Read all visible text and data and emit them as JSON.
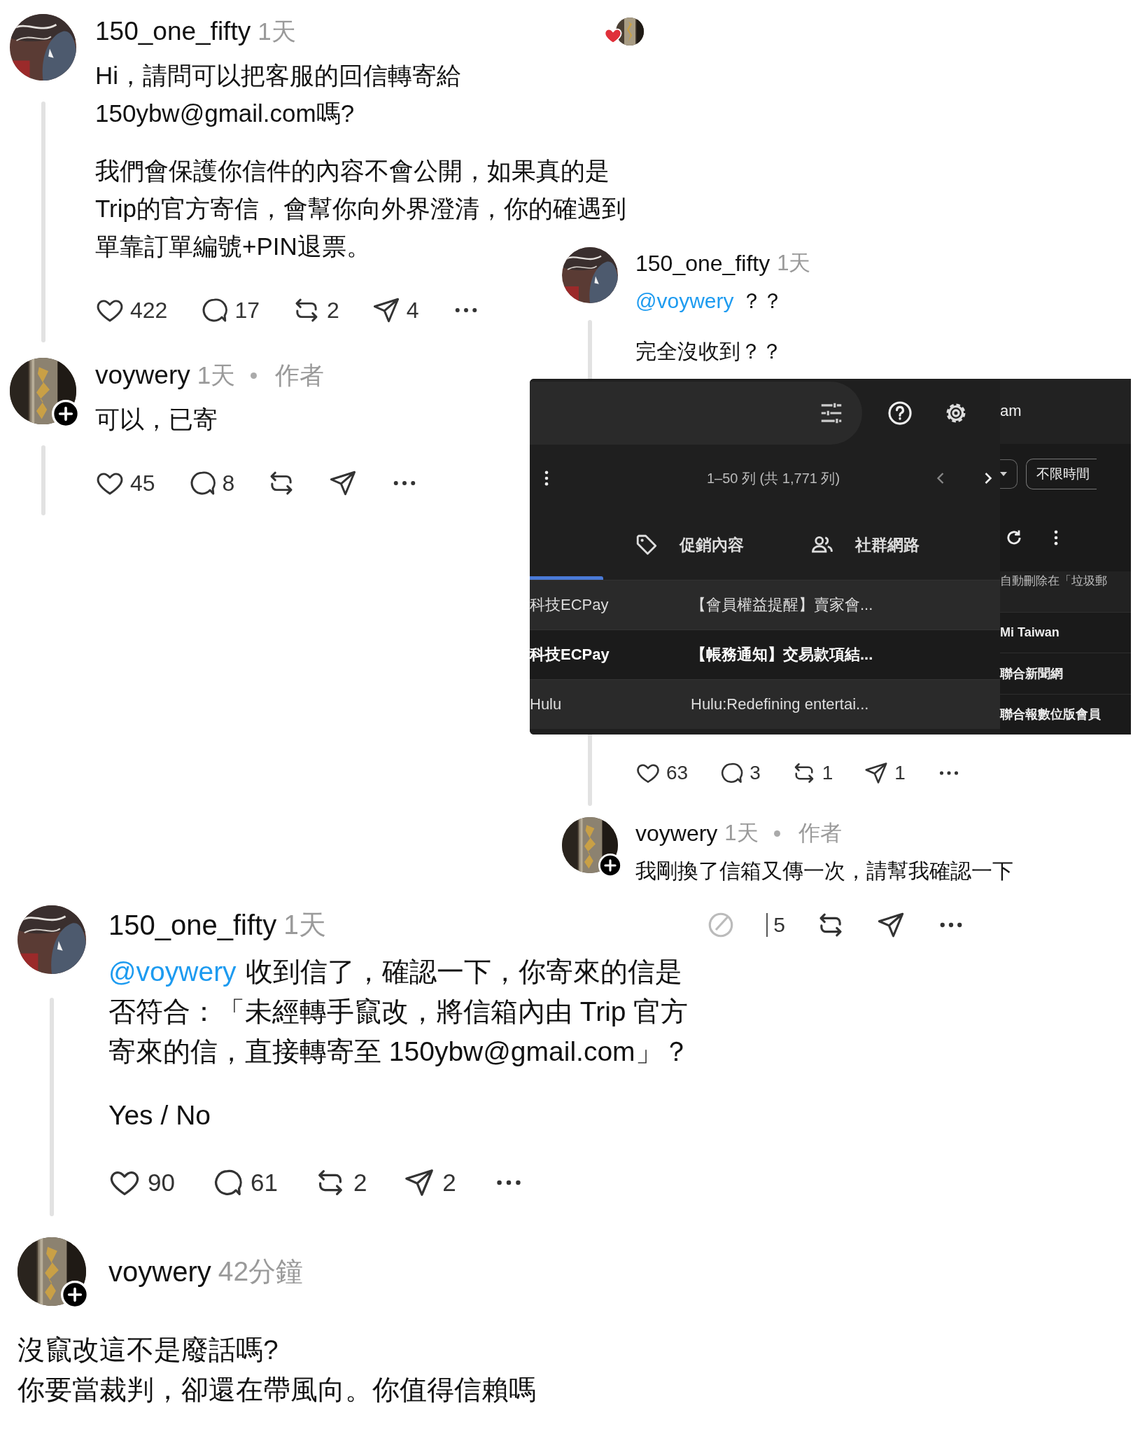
{
  "threads": [
    {
      "posts": [
        {
          "author": "150_one_fifty",
          "time": "1天",
          "thread_line": true,
          "liked_by_author": true,
          "paragraphs": [
            {
              "text": "Hi，請問可以把客服的回信轉寄給150ybw@gmail.com嗎?"
            },
            {
              "text": "我們會保護你信件的內容不會公開，如果真的是Trip的官方寄信，會幫你向外界澄清，你的確遇到單靠訂單編號+PIN退票。"
            }
          ],
          "actions": [
            {
              "kind": "like",
              "count": "422"
            },
            {
              "kind": "reply",
              "count": "17"
            },
            {
              "kind": "repost",
              "count": "2"
            },
            {
              "kind": "share",
              "count": "4"
            },
            {
              "kind": "more"
            }
          ]
        },
        {
          "author": "voywery",
          "time": "1天",
          "role": "作者",
          "follow_button": true,
          "thread_line": true,
          "paragraphs": [
            {
              "text": "可以，已寄"
            }
          ],
          "actions": [
            {
              "kind": "like",
              "count": "45"
            },
            {
              "kind": "reply",
              "count": "8"
            },
            {
              "kind": "repost"
            },
            {
              "kind": "share"
            },
            {
              "kind": "more"
            }
          ]
        }
      ]
    },
    {
      "posts": [
        {
          "author": "150_one_fifty",
          "time": "1天",
          "thread_line": true,
          "paragraphs": [
            {
              "mention": "@voywery",
              "text": "？？"
            },
            {
              "text": "完全沒收到？？"
            }
          ],
          "attachment": {
            "kind": "mail_screenshot",
            "pager": "1–50 列 (共 1,771 列)",
            "tabs": [
              {
                "label": "促銷內容"
              },
              {
                "label": "社群網路"
              }
            ],
            "rows": [
              {
                "sender": "科技ECPay",
                "subject": "【會員權益提醒】賣家會...",
                "unread": false
              },
              {
                "sender": "科技ECPay",
                "subject": "【帳務通知】交易款項結...",
                "unread": true
              },
              {
                "sender": "Hulu",
                "subject": "Hulu:Redefining entertai...",
                "unread": false
              }
            ],
            "side_panel": {
              "header": "am",
              "filter_chip": "不限時間",
              "notice": "自動刪除在「垃圾郵",
              "senders": [
                "Mi Taiwan",
                "聯合新聞網",
                "聯合報數位版會員"
              ]
            }
          },
          "actions": [
            {
              "kind": "like",
              "count": "63"
            },
            {
              "kind": "reply",
              "count": "3"
            },
            {
              "kind": "repost",
              "count": "1"
            },
            {
              "kind": "share",
              "count": "1"
            },
            {
              "kind": "more"
            }
          ]
        },
        {
          "author": "voywery",
          "time": "1天",
          "role": "作者",
          "follow_button": true,
          "paragraphs": [
            {
              "text": "我剛換了信箱又傳一次，請幫我確認一下"
            }
          ]
        }
      ]
    },
    {
      "posts": [
        {
          "author": "150_one_fifty",
          "time": "1天",
          "thread_line": true,
          "stray_actions": [
            {
              "kind": "edit"
            },
            {
              "kind": "partial",
              "count": "5"
            },
            {
              "kind": "repost"
            },
            {
              "kind": "share"
            },
            {
              "kind": "more"
            }
          ],
          "paragraphs": [
            {
              "mention": "@voywery",
              "text": "收到信了，確認一下，你寄來的信是否符合：「未經轉手竄改，將信箱內由 Trip 官方寄來的信，直接轉寄至 150ybw@gmail.com」？"
            },
            {
              "text": "Yes / No"
            }
          ],
          "actions": [
            {
              "kind": "like",
              "count": "90"
            },
            {
              "kind": "reply",
              "count": "61"
            },
            {
              "kind": "repost",
              "count": "2"
            },
            {
              "kind": "share",
              "count": "2"
            },
            {
              "kind": "more"
            }
          ]
        },
        {
          "author": "voywery",
          "time": "42分鐘",
          "follow_button": true,
          "full_width_body": true,
          "paragraphs": [
            {
              "text": "沒竄改這不是廢話嗎?"
            },
            {
              "text": "你要當裁判，卻還在帶風向。你值得信賴嗎"
            }
          ]
        }
      ]
    }
  ]
}
